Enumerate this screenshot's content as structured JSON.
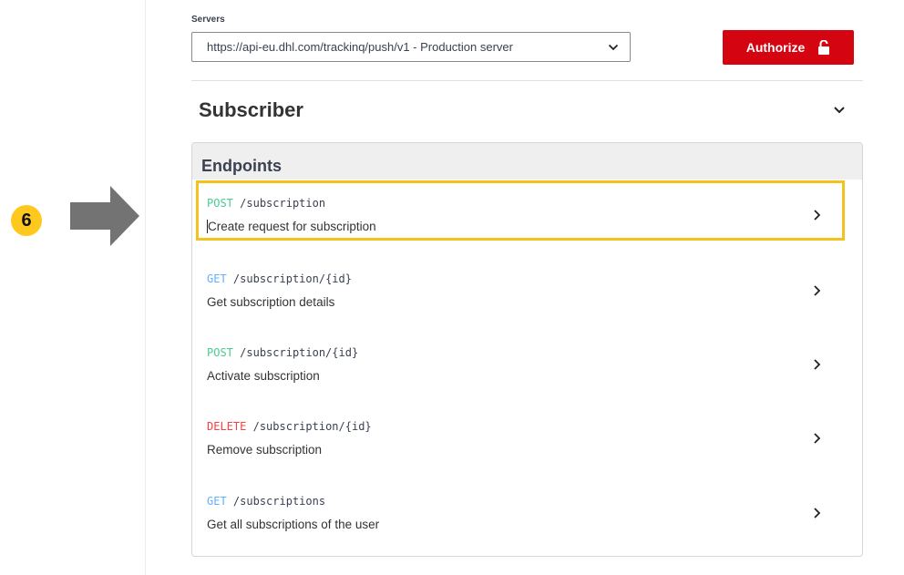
{
  "callout": {
    "step_number": "6"
  },
  "servers": {
    "label": "Servers",
    "selected": "https://api-eu.dhl.com/trackinq/push/v1 - Production server"
  },
  "authorize": {
    "label": "Authorize"
  },
  "tag": {
    "title": "Subscriber"
  },
  "endpoints": {
    "title": "Endpoints",
    "items": [
      {
        "method": "POST",
        "path": "/subscription",
        "summary": "Create request for subscription"
      },
      {
        "method": "GET",
        "path": "/subscription/{id}",
        "summary": "Get subscription details"
      },
      {
        "method": "POST",
        "path": "/subscription/{id}",
        "summary": "Activate subscription"
      },
      {
        "method": "DELETE",
        "path": "/subscription/{id}",
        "summary": "Remove subscription"
      },
      {
        "method": "GET",
        "path": "/subscriptions",
        "summary": "Get all subscriptions of the user"
      }
    ]
  },
  "colors": {
    "brand_red": "#d40511",
    "highlight": "#f4c21c",
    "post": "#49cc90",
    "get": "#61affe",
    "delete": "#f93e3e"
  }
}
